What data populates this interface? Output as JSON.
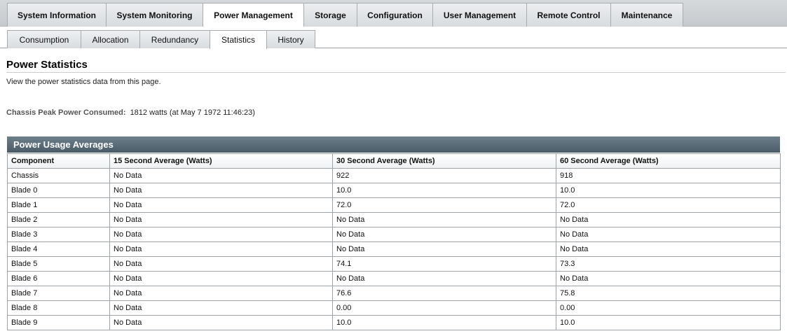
{
  "top_tabs": [
    {
      "label": "System Information",
      "active": false
    },
    {
      "label": "System Monitoring",
      "active": false
    },
    {
      "label": "Power Management",
      "active": true
    },
    {
      "label": "Storage",
      "active": false
    },
    {
      "label": "Configuration",
      "active": false
    },
    {
      "label": "User Management",
      "active": false
    },
    {
      "label": "Remote Control",
      "active": false
    },
    {
      "label": "Maintenance",
      "active": false
    }
  ],
  "sub_tabs": [
    {
      "label": "Consumption",
      "active": false
    },
    {
      "label": "Allocation",
      "active": false
    },
    {
      "label": "Redundancy",
      "active": false
    },
    {
      "label": "Statistics",
      "active": true
    },
    {
      "label": "History",
      "active": false
    }
  ],
  "page": {
    "title": "Power Statistics",
    "description": "View the power statistics data from this page.",
    "peak_label": "Chassis Peak Power Consumed:",
    "peak_value": "1812 watts (at May 7 1972 11:46:23)"
  },
  "panel": {
    "title": "Power Usage Averages",
    "columns": [
      "Component",
      "15 Second Average (Watts)",
      "30 Second Average (Watts)",
      "60 Second Average (Watts)"
    ],
    "rows": [
      [
        "Chassis",
        "No Data",
        "922",
        "918"
      ],
      [
        "Blade 0",
        "No Data",
        "10.0",
        "10.0"
      ],
      [
        "Blade 1",
        "No Data",
        "72.0",
        "72.0"
      ],
      [
        "Blade 2",
        "No Data",
        "No Data",
        "No Data"
      ],
      [
        "Blade 3",
        "No Data",
        "No Data",
        "No Data"
      ],
      [
        "Blade 4",
        "No Data",
        "No Data",
        "No Data"
      ],
      [
        "Blade 5",
        "No Data",
        "74.1",
        "73.3"
      ],
      [
        "Blade 6",
        "No Data",
        "No Data",
        "No Data"
      ],
      [
        "Blade 7",
        "No Data",
        "76.6",
        "75.8"
      ],
      [
        "Blade 8",
        "No Data",
        "0.00",
        "0.00"
      ],
      [
        "Blade 9",
        "No Data",
        "10.0",
        "10.0"
      ]
    ]
  }
}
